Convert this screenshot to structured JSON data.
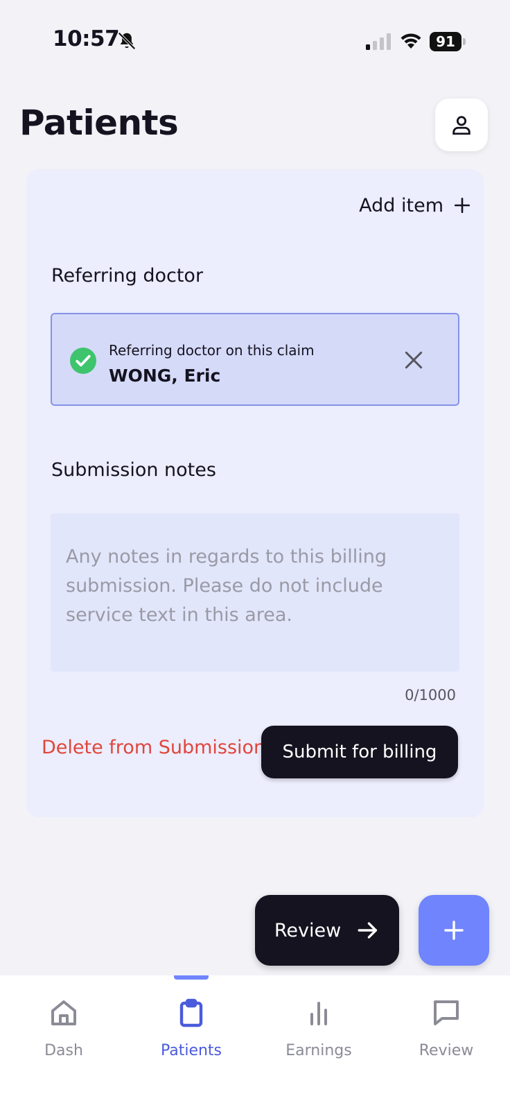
{
  "status_bar": {
    "time": "10:57",
    "battery": "91"
  },
  "header": {
    "title": "Patients"
  },
  "card": {
    "add_item_label": "Add item",
    "referring_doctor": {
      "section_label": "Referring doctor",
      "caption": "Referring doctor on this claim",
      "name": "WONG, Eric"
    },
    "submission_notes": {
      "section_label": "Submission notes",
      "value": "",
      "placeholder": "Any notes in regards to this billing submission. Please do not include service text in this area.",
      "char_count": "0/1000"
    },
    "delete_label": "Delete from Submission",
    "submit_label": "Submit for billing"
  },
  "fab": {
    "review_label": "Review"
  },
  "nav": {
    "items": [
      {
        "label": "Dash",
        "icon": "home-icon"
      },
      {
        "label": "Patients",
        "icon": "clipboard-icon",
        "active": true
      },
      {
        "label": "Earnings",
        "icon": "bar-chart-icon"
      },
      {
        "label": "Review",
        "icon": "chat-icon"
      }
    ]
  },
  "colors": {
    "accent": "#6f84fd",
    "active_nav": "#4a5bdc",
    "danger": "#e0463b",
    "success": "#3ec46d",
    "dark": "#15131f"
  }
}
